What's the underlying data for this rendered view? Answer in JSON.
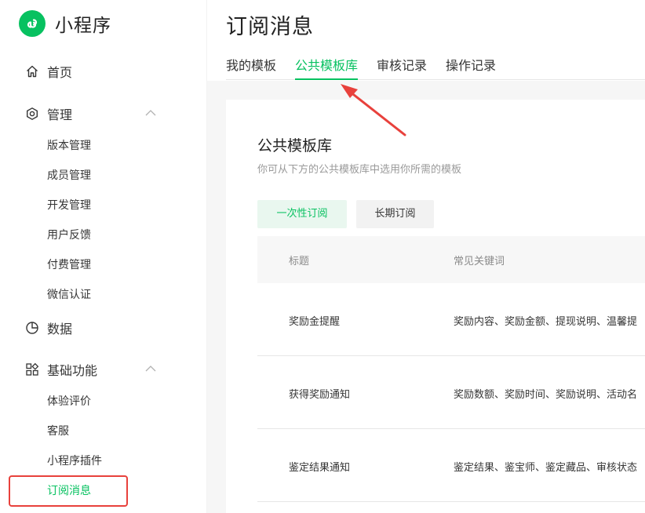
{
  "app": {
    "title": "小程序"
  },
  "sidebar": {
    "home": "首页",
    "manage": {
      "label": "管理",
      "items": [
        "版本管理",
        "成员管理",
        "开发管理",
        "用户反馈",
        "付费管理",
        "微信认证"
      ]
    },
    "data": "数据",
    "basic": {
      "label": "基础功能",
      "items": [
        "体验评价",
        "客服",
        "小程序插件",
        "订阅消息"
      ]
    }
  },
  "main": {
    "title": "订阅消息",
    "tabs": [
      "我的模板",
      "公共模板库",
      "审核记录",
      "操作记录"
    ],
    "active_tab": "公共模板库",
    "section_title": "公共模板库",
    "section_desc": "你可从下方的公共模板库中选用你所需的模板",
    "buttons": {
      "one_time": "一次性订阅",
      "long_term": "长期订阅"
    },
    "table": {
      "columns": [
        "标题",
        "常见关键词"
      ],
      "rows": [
        {
          "title": "奖励金提醒",
          "keywords": "奖励内容、奖励金额、提现说明、温馨提"
        },
        {
          "title": "获得奖励通知",
          "keywords": "奖励数额、奖励时间、奖励说明、活动名"
        },
        {
          "title": "鉴定结果通知",
          "keywords": "鉴定结果、鉴宝师、鉴定藏品、审核状态"
        }
      ]
    }
  },
  "colors": {
    "accent": "#07c160",
    "highlight": "#e8413c"
  },
  "icons": {
    "logo": "miniprogram-logo-icon",
    "home": "home-icon",
    "manage": "settings-hexagon-icon",
    "data": "pie-chart-icon",
    "basic": "grid-apps-icon",
    "chevron": "chevron-up-icon",
    "annotation": "red-arrow-annotation"
  }
}
